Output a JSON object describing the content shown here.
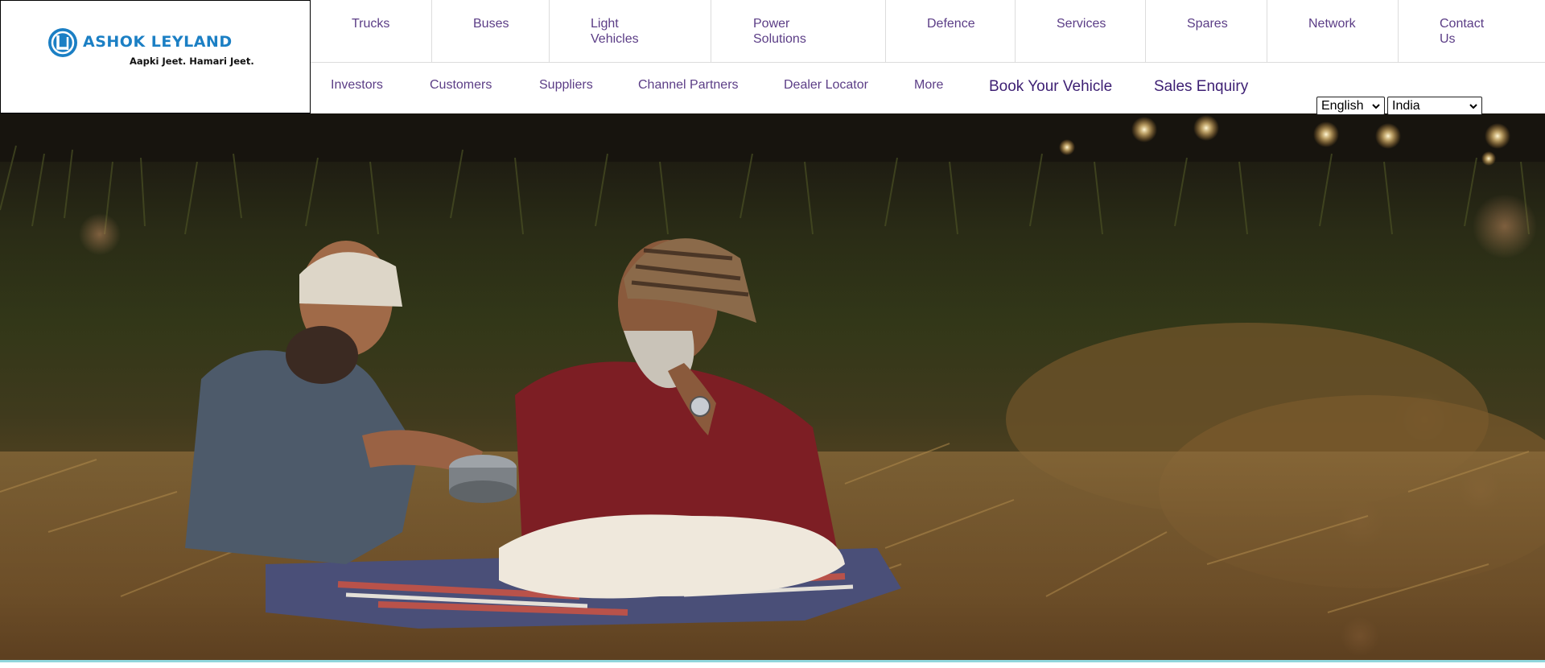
{
  "brand": {
    "name": "ASHOK LEYLAND",
    "tagline": "Aapki Jeet. Hamari Jeet.",
    "color": "#1b7fc4"
  },
  "nav": {
    "primary": [
      {
        "label": "Trucks"
      },
      {
        "label": "Buses"
      },
      {
        "label": "Light Vehicles"
      },
      {
        "label": "Power Solutions"
      },
      {
        "label": "Defence"
      },
      {
        "label": "Services"
      },
      {
        "label": "Spares"
      },
      {
        "label": "Network"
      },
      {
        "label": "Contact Us"
      }
    ],
    "secondary": [
      {
        "label": "Investors"
      },
      {
        "label": "Customers"
      },
      {
        "label": "Suppliers"
      },
      {
        "label": "Channel Partners"
      },
      {
        "label": "Dealer Locator"
      },
      {
        "label": "More"
      }
    ],
    "cta": {
      "book": "Book Your Vehicle",
      "enquiry": "Sales Enquiry"
    }
  },
  "selectors": {
    "language": "English",
    "country": "India"
  },
  "hero": {
    "icon": "hero-photo"
  },
  "colors": {
    "nav_text": "#5b3d86",
    "cta_text": "#3d1f73",
    "divider": "#dcdcdc",
    "bottom_strip": "#8fd6dc"
  }
}
